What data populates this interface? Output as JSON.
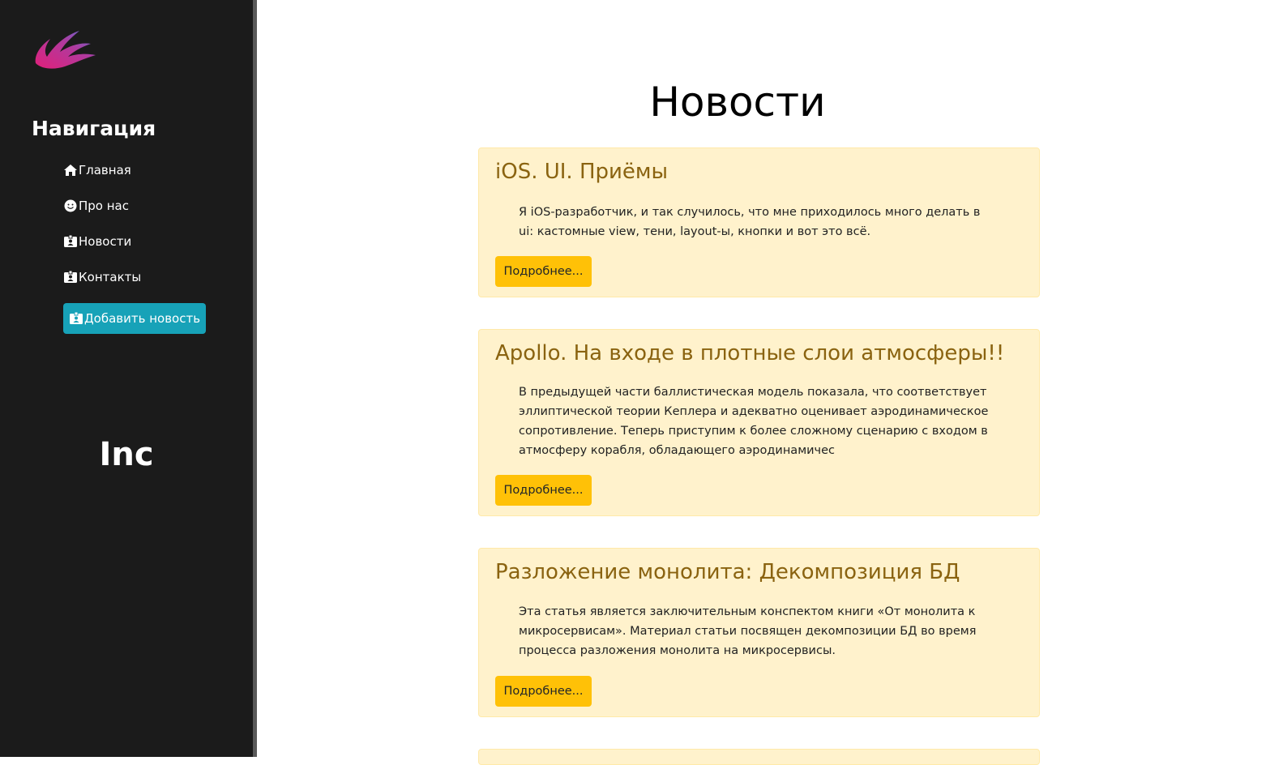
{
  "sidebar": {
    "logo_icon": "bird-wing-logo",
    "heading": "Навигация",
    "items": [
      {
        "label": "Главная",
        "icon": "home-icon"
      },
      {
        "label": "Про нас",
        "icon": "smiley-icon"
      },
      {
        "label": "Новости",
        "icon": "id-badge-icon"
      },
      {
        "label": "Контакты",
        "icon": "id-badge-icon"
      }
    ],
    "add_button": {
      "label": "Добавить новость",
      "icon": "id-badge-icon",
      "color": "#17a2b8"
    },
    "brand": "Inc"
  },
  "main": {
    "title": "Новости",
    "articles": [
      {
        "title": "iOS. UI. Приёмы",
        "excerpt": "Я iOS-разработчик, и так случилось, что мне приходилось много делать в ui: кастомные view, тени, layout-ы, кнопки и вот это всё.",
        "button": "Подробнее..."
      },
      {
        "title": "Apollo. На входе в плотные слои атмосферы!!",
        "excerpt": "В предыдущей части баллистическая модель показала, что соответствует эллиптической теории Кеплера и адекватно оценивает аэродинамическое сопротивление. Теперь приступим к более сложному сценарию с входом в атмосферу корабля, обладающего аэродинамичес",
        "button": "Подробнее..."
      },
      {
        "title": "Разложение монолита: Декомпозиция БД",
        "excerpt": "Эта статья является заключительным конспектом книги «От монолита к микросервисам». Материал статьи посвящен декомпозиции БД во время процесса разложения монолита на микросервисы.",
        "button": "Подробнее..."
      }
    ]
  },
  "colors": {
    "sidebar_bg": "#1b1b1b",
    "card_bg": "#fff2cc",
    "card_title": "#8a6310",
    "button_warning": "#ffc107",
    "button_info": "#17a2b8"
  }
}
